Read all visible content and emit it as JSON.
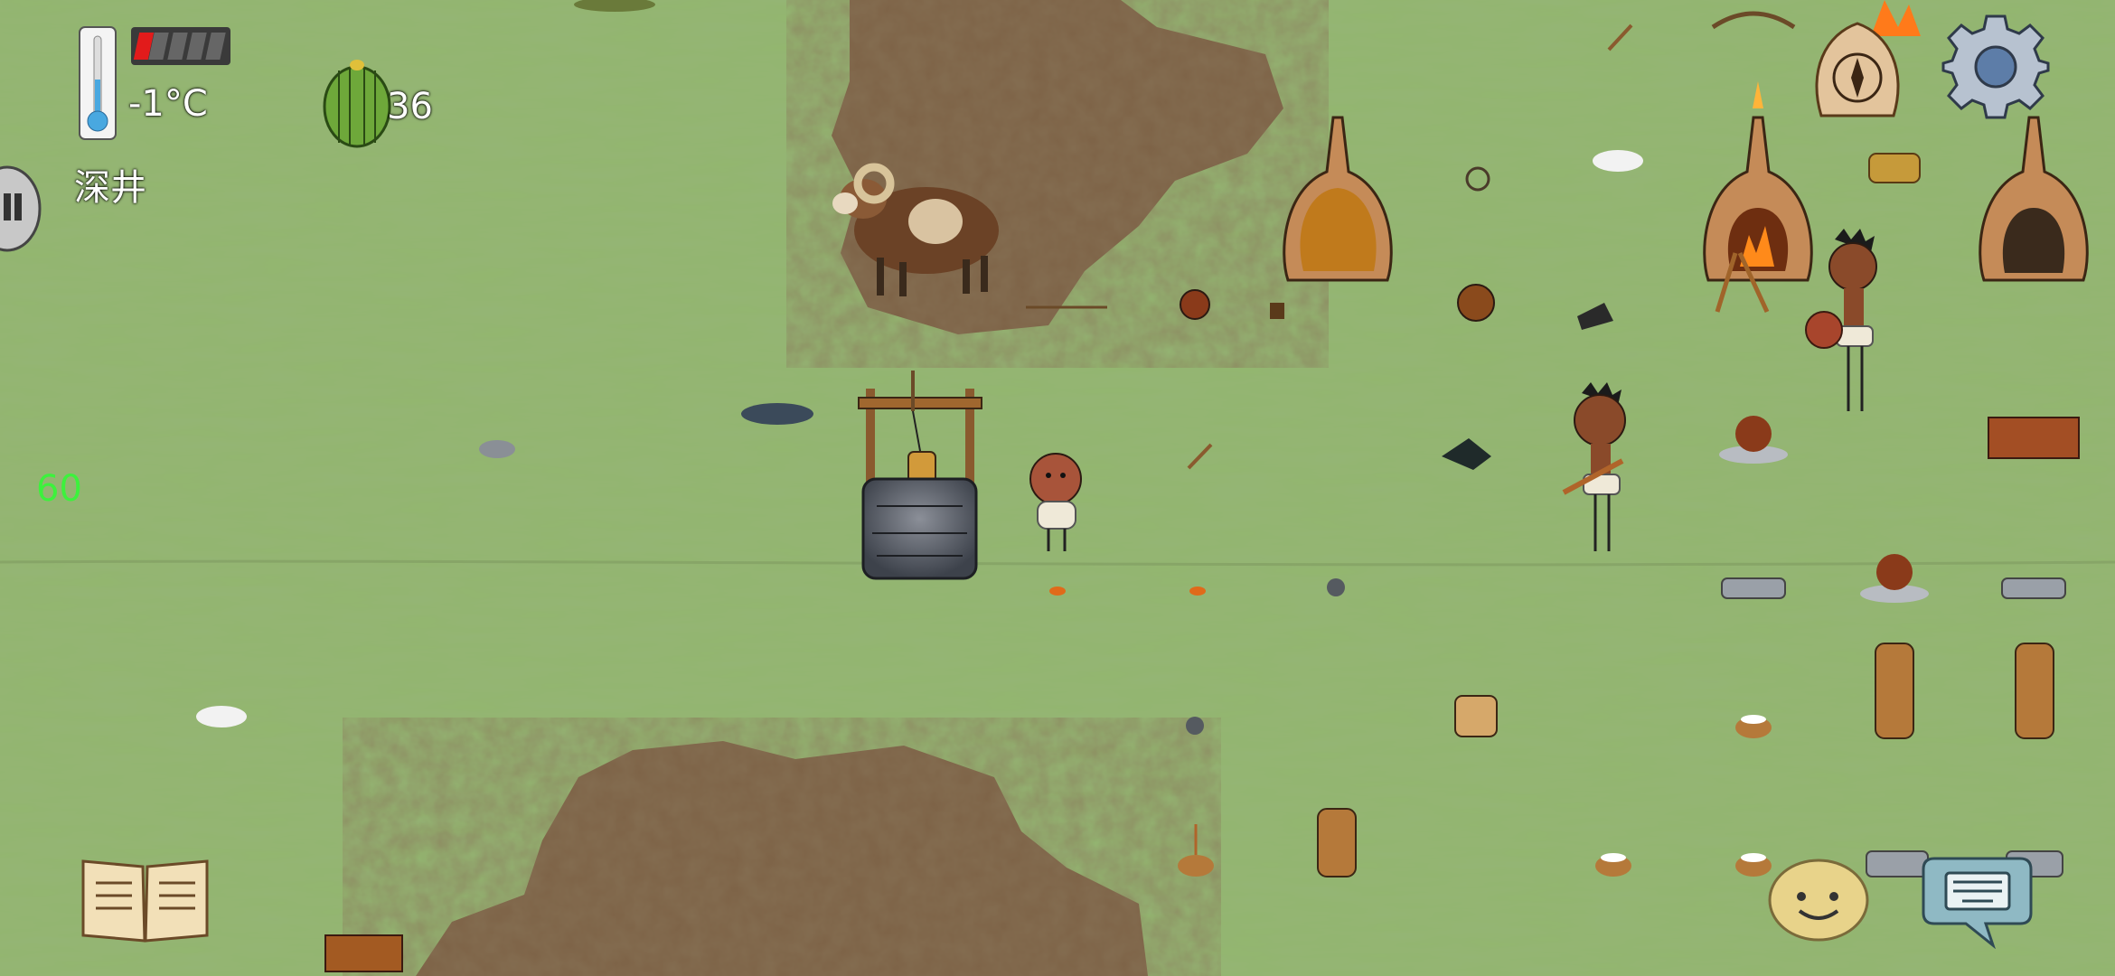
{
  "hud": {
    "temperature": "-1°C",
    "location_label": "深井",
    "food_count": "36",
    "fps": "60",
    "food_pips_filled": 1,
    "food_pips_total": 5
  },
  "buttons": {
    "settings_icon": "gear-icon",
    "compass_icon": "compass-bag-icon",
    "book_icon": "recipe-book-icon",
    "emote_icon": "emote-face-icon",
    "chat_icon": "keyboard-chat-icon",
    "pause_icon": "pause-icon"
  },
  "colors": {
    "grass": "#8fb46c",
    "dirt": "#7a5f43",
    "fps_text": "#3cf23c",
    "food_pip_red": "#e21b1b"
  }
}
